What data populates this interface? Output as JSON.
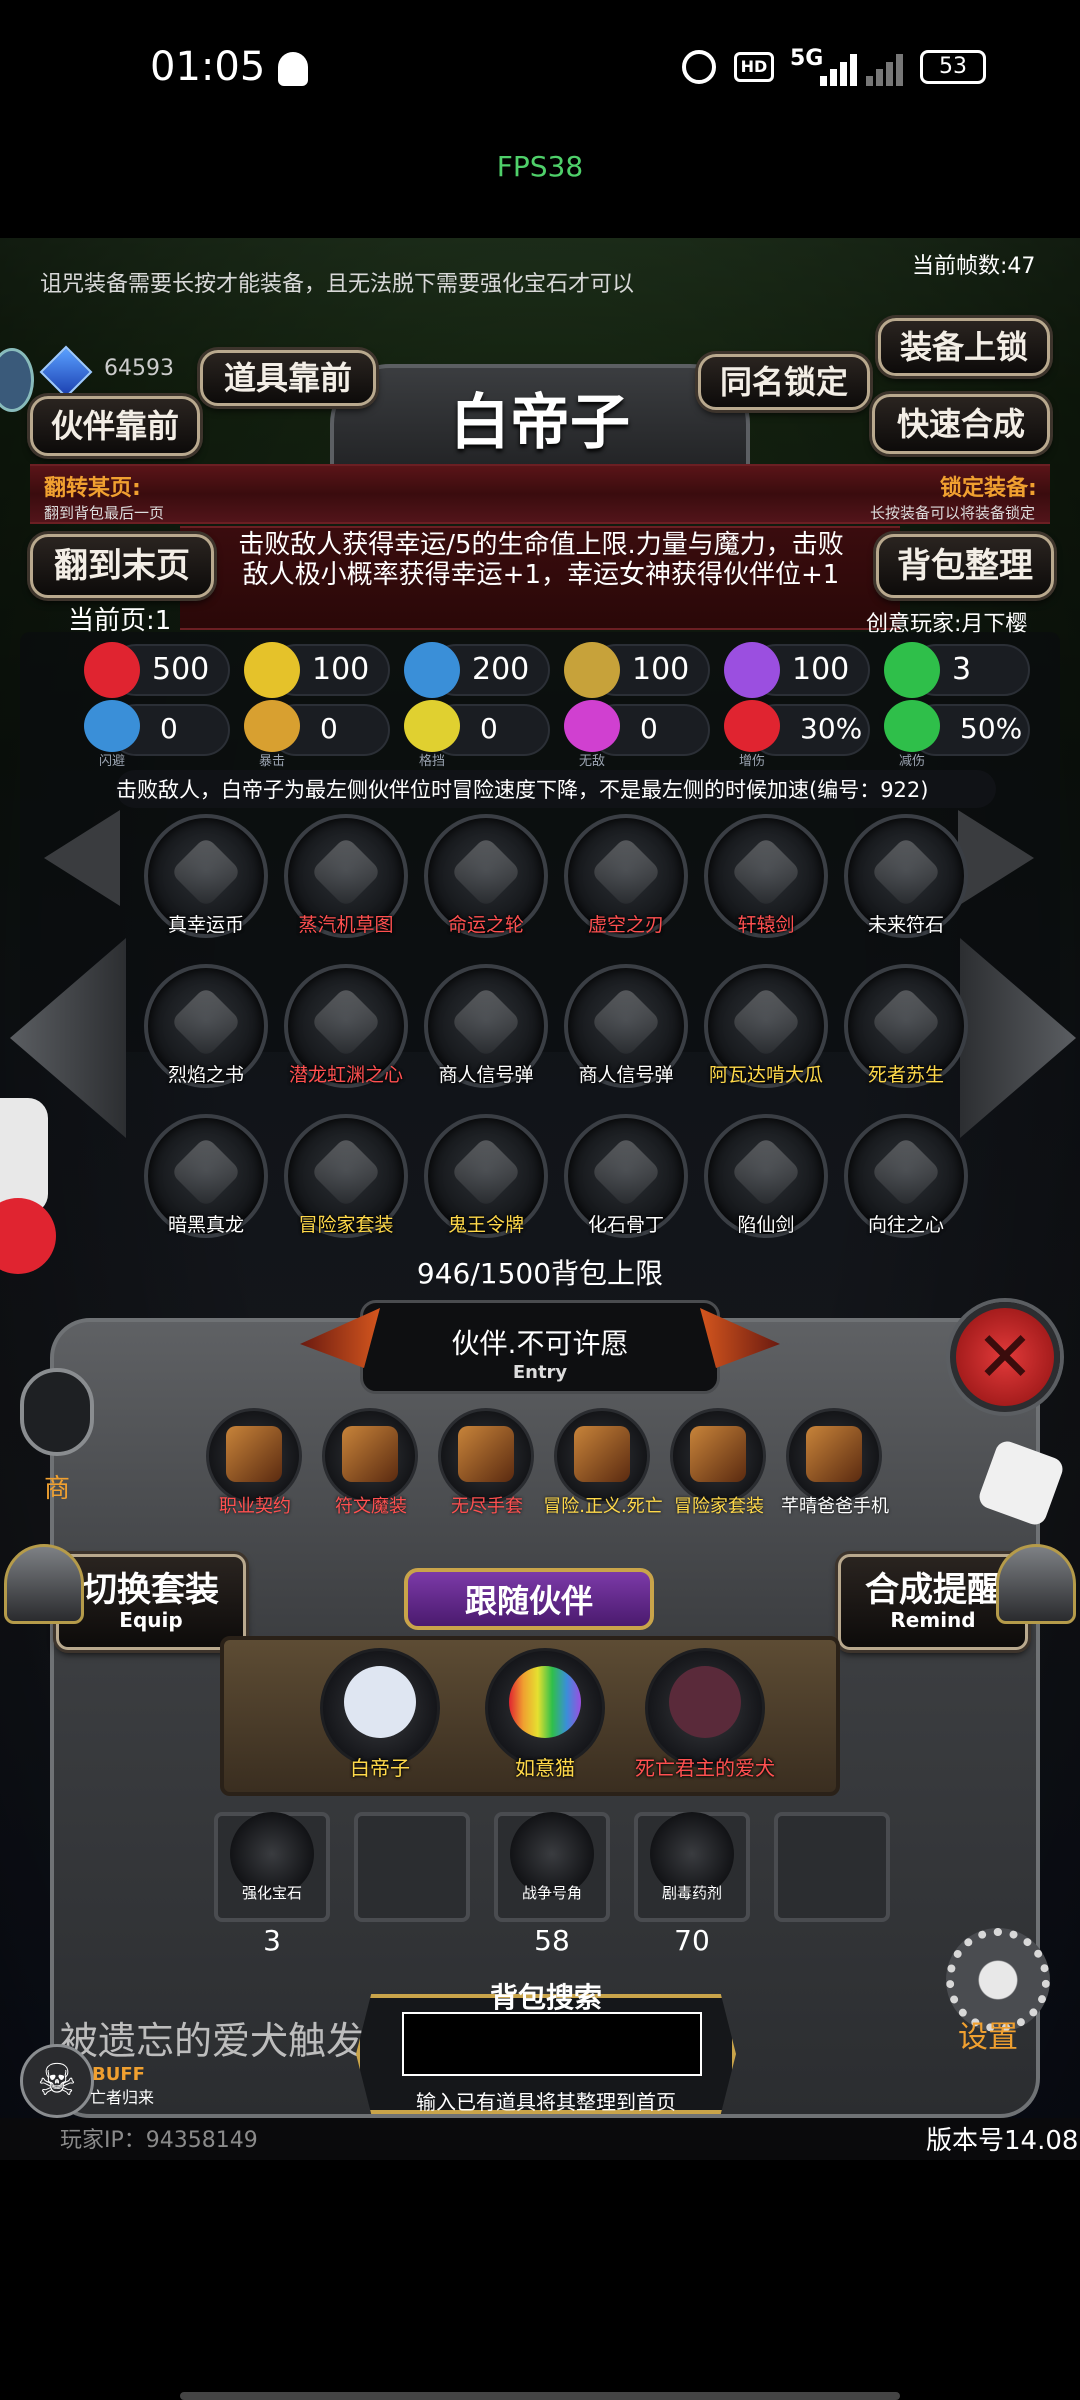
{
  "status_bar": {
    "time": "01:05",
    "battery": "53",
    "signal_label": "5G"
  },
  "fps": "FPS38",
  "frame_count": "当前帧数:47",
  "notice": "诅咒装备需要长按才能装备，且无法脱下需要强化宝石才可以",
  "gem_count": "64593",
  "buttons": {
    "item_front": "道具靠前",
    "partner_front": "伙伴靠前",
    "same_name_lock": "同名锁定",
    "equip_lock": "装备上锁",
    "quick_craft": "快速合成",
    "to_last_page": "翻到末页",
    "bag_sort": "背包整理",
    "switch_set": "切换套装",
    "switch_set_sub": "Equip",
    "craft_remind": "合成提醒",
    "craft_remind_sub": "Remind",
    "follow_partner": "跟随伙伴",
    "settings": "设置",
    "shop": "商"
  },
  "hero": {
    "name": "白帝子"
  },
  "flip_page": {
    "title": "翻转某页:",
    "subtitle": "翻到背包最后一页"
  },
  "lock_equip": {
    "title": "锁定装备:",
    "subtitle": "长按装备可以将装备锁定"
  },
  "description": "击败敌人获得幸运/5的生命值上限.力量与魔力，击败敌人极小概率获得幸运+1，幸运女神获得伙伴位+1",
  "current_page": "当前页:1",
  "creator": "创意玩家:月下樱",
  "stats_row1": [
    {
      "icon": "heart-icon",
      "value": "500",
      "color": "#e02430"
    },
    {
      "icon": "strength-icon",
      "value": "100",
      "color": "#e5c22a"
    },
    {
      "icon": "armor-icon",
      "value": "200",
      "color": "#3a8fd8"
    },
    {
      "icon": "sword-icon",
      "value": "100",
      "color": "#c7a23a"
    },
    {
      "icon": "lightning-icon",
      "value": "100",
      "color": "#9b4fe0"
    },
    {
      "icon": "clover-icon",
      "value": "3",
      "color": "#2fbf4a"
    }
  ],
  "stats_row2": [
    {
      "icon": "dodge-icon",
      "value": "0",
      "label": "闪避",
      "color": "#3a8fd8"
    },
    {
      "icon": "crit-icon",
      "value": "0",
      "label": "暴击",
      "color": "#d8a030"
    },
    {
      "icon": "block-icon",
      "value": "0",
      "label": "格挡",
      "color": "#e0d030"
    },
    {
      "icon": "invincible-icon",
      "value": "0",
      "label": "无敌",
      "color": "#d040d0"
    },
    {
      "icon": "damage-up-icon",
      "value": "30%",
      "label": "增伤",
      "color": "#e02430"
    },
    {
      "icon": "damage-reduce-icon",
      "value": "50%",
      "label": "减伤",
      "color": "#2fbf4a"
    }
  ],
  "effect_note": "击败敌人，白帝子为最左侧伙伴位时冒险速度下降，不是最左侧的时候加速(编号：922)",
  "items": [
    {
      "name": "真幸运币",
      "color": "#ffffff"
    },
    {
      "name": "蒸汽机草图",
      "color": "#ff5050"
    },
    {
      "name": "命运之轮",
      "color": "#ff5050"
    },
    {
      "name": "虚空之刃",
      "color": "#ff5050"
    },
    {
      "name": "轩辕剑",
      "color": "#ff5050"
    },
    {
      "name": "未来符石",
      "color": "#ffffff"
    },
    {
      "name": "烈焰之书",
      "color": "#ffffff"
    },
    {
      "name": "潜龙虹渊之心",
      "color": "#ff5050"
    },
    {
      "name": "商人信号弹",
      "color": "#ffffff"
    },
    {
      "name": "商人信号弹",
      "color": "#ffffff"
    },
    {
      "name": "阿瓦达啃大瓜",
      "color": "#ffd94a"
    },
    {
      "name": "死者苏生",
      "color": "#ffd94a"
    },
    {
      "name": "暗黑真龙",
      "color": "#ffffff"
    },
    {
      "name": "冒险家套装",
      "color": "#ffd94a"
    },
    {
      "name": "鬼王令牌",
      "color": "#ffd94a"
    },
    {
      "name": "化石骨丁",
      "color": "#ffffff"
    },
    {
      "name": "陷仙剑",
      "color": "#ffffff"
    },
    {
      "name": "向往之心",
      "color": "#ffffff"
    }
  ],
  "bag_limit": "946/1500背包上限",
  "entry": {
    "title": "伙伴.不可许愿",
    "sub": "Entry"
  },
  "entry_items": [
    {
      "name": "职业契约",
      "color": "#ff5050"
    },
    {
      "name": "符文魔装",
      "color": "#ff5050"
    },
    {
      "name": "无尽手套",
      "color": "#ff5050"
    },
    {
      "name": "冒险.正义.死亡",
      "color": "#ffd94a"
    },
    {
      "name": "冒险家套装",
      "color": "#ffd94a"
    },
    {
      "name": "芊晴爸爸手机",
      "color": "#ffffff"
    }
  ],
  "partners": [
    {
      "name": "白帝子",
      "color": "#ffd94a"
    },
    {
      "name": "如意猫",
      "color": "#ffd94a"
    },
    {
      "name": "死亡君主的爱犬",
      "color": "#ff5050"
    }
  ],
  "consumables": [
    {
      "name": "强化宝石",
      "count": "3"
    },
    {
      "name": "",
      "count": ""
    },
    {
      "name": "战争号角",
      "count": "58"
    },
    {
      "name": "剧毒药剂",
      "count": "70"
    },
    {
      "name": "",
      "count": ""
    }
  ],
  "search": {
    "title": "背包搜索",
    "hint": "输入已有道具将其整理到首页",
    "value": ""
  },
  "buff": {
    "label": "BUFF",
    "sub": "亡者归来"
  },
  "scroll_text": "被遗忘的爱犬触发",
  "player_ip": "玩家IP：94358149",
  "version": "版本号14.08"
}
